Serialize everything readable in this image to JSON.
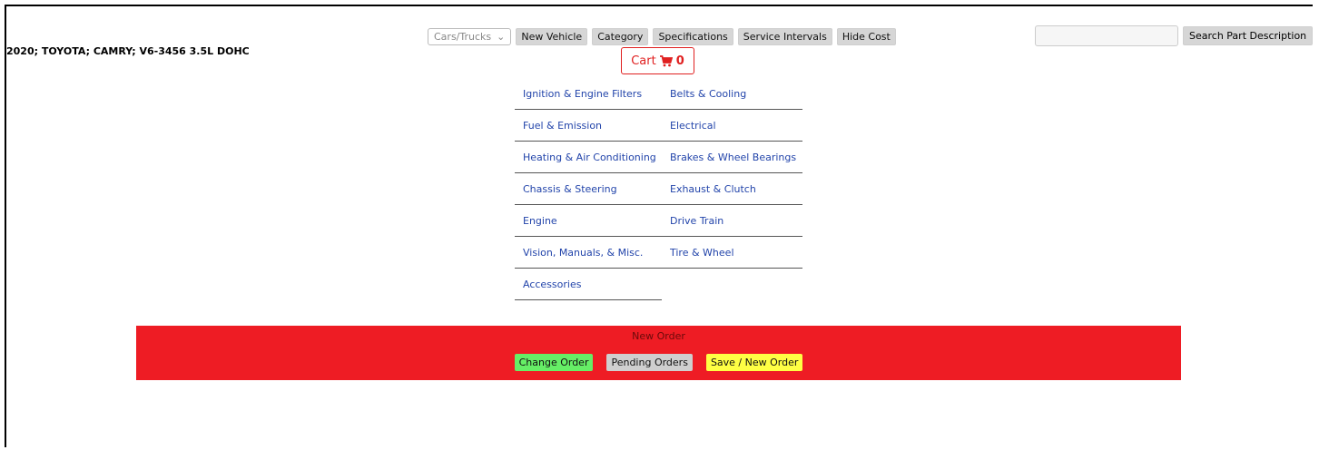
{
  "vehicle": "2020; TOYOTA; CAMRY; V6-3456 3.5L DOHC",
  "toolbar": {
    "vehicle_type": "Cars/Trucks",
    "buttons": [
      "New Vehicle",
      "Category",
      "Specifications",
      "Service Intervals",
      "Hide Cost"
    ]
  },
  "cart": {
    "label": "Cart",
    "count": "0"
  },
  "search": {
    "placeholder": "",
    "button": "Search Part Description"
  },
  "categories": [
    "Ignition & Engine Filters",
    "Belts & Cooling",
    "Fuel & Emission",
    "Electrical",
    "Heating & Air Conditioning",
    "Brakes & Wheel Bearings",
    "Chassis & Steering",
    "Exhaust & Clutch",
    "Engine",
    "Drive Train",
    "Vision, Manuals, & Misc.",
    "Tire & Wheel",
    "Accessories"
  ],
  "order": {
    "title": "New Order",
    "buttons": [
      "Change Order",
      "Pending Orders",
      "Save / New Order"
    ]
  },
  "colors": {
    "order_bar": "#ee1c24",
    "link": "#2244aa",
    "cart": "#e02020"
  }
}
